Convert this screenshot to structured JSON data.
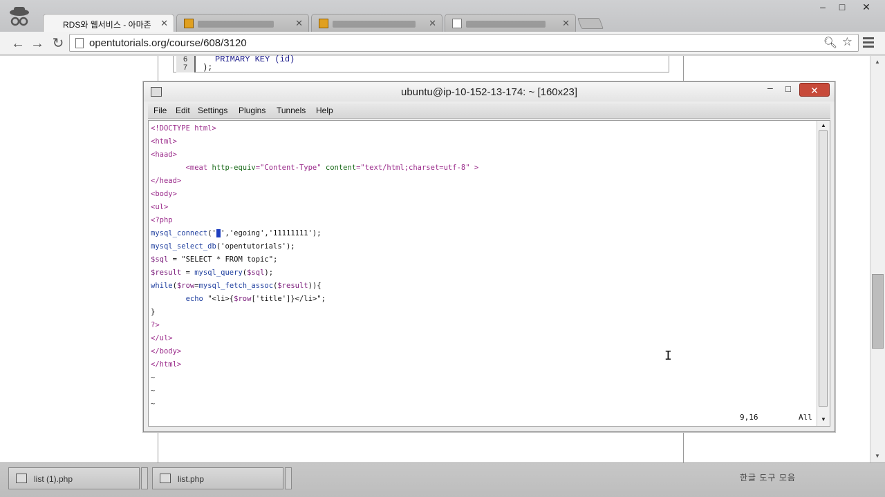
{
  "browser": {
    "tabs": [
      {
        "label": "RDS와 웹서비스 - 아마존",
        "active": true
      },
      {
        "label": "",
        "active": false
      },
      {
        "label": "",
        "active": false
      },
      {
        "label": "",
        "active": false
      }
    ],
    "url": "opentutorials.org/course/608/3120",
    "window_controls": {
      "minimize": "–",
      "maximize": "□",
      "close": "✕"
    }
  },
  "page_code": {
    "line_numbers": [
      "6",
      "7"
    ],
    "line1": "PRIMARY KEY (id)",
    "line2": ");"
  },
  "terminal": {
    "title": "ubuntu@ip-10-152-13-174: ~ [160x23]",
    "menu": [
      "File",
      "Edit",
      "Settings",
      "Plugins",
      "Tunnels",
      "Help"
    ],
    "lines": [
      "<!DOCTYPE html>",
      "<html>",
      "<haad>",
      "        <meat http-equiv=\"Content-Type\" content=\"text/html;charset=utf-8\" >",
      "</head>",
      "<body>",
      "<ul>",
      "<?php",
      "mysql_connect(' ','egoing','11111111');",
      "mysql_select_db('opentutorials');",
      "$sql = \"SELECT * FROM topic\";",
      "$result = mysql_query($sql);",
      "while($row=mysql_fetch_assoc($result)){",
      "        echo \"<li>{$row['title']}</li>\";",
      "}",
      "?>",
      "</ul>",
      "</body>",
      "</html>",
      "~",
      "~",
      "~"
    ],
    "cursor_position": "9,16",
    "scroll_position": "All"
  },
  "taskbar": {
    "items": [
      "list (1).php",
      "list.php"
    ],
    "tray_text": "한글 도구 모음"
  },
  "colors": {
    "close_button": "#c74a3a",
    "cursor_highlight": "#1f3fc0"
  }
}
